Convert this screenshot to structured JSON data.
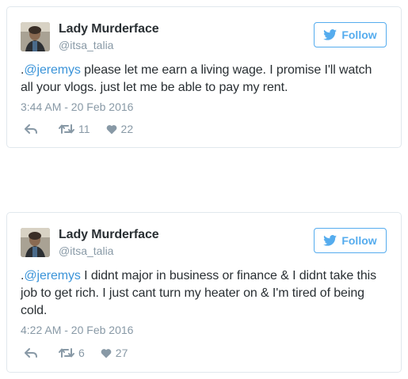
{
  "tweets": [
    {
      "display_name": "Lady Murderface",
      "handle": "@itsa_talia",
      "follow_label": "Follow",
      "text_prefix": ".",
      "mention": "@jeremys",
      "text_body": " please let me earn a living wage. I promise I'll watch all your vlogs. just let me be able to pay my rent.",
      "timestamp": "3:44 AM - 20 Feb 2016",
      "retweets": "11",
      "likes": "22"
    },
    {
      "display_name": "Lady Murderface",
      "handle": "@itsa_talia",
      "follow_label": "Follow",
      "text_prefix": ".",
      "mention": "@jeremys",
      "text_body": " I didnt major in business or finance & I didnt take this job to get rich. I just cant turn my heater on & I'm tired of being cold.",
      "timestamp": "4:22 AM - 20 Feb 2016",
      "retweets": "6",
      "likes": "27"
    }
  ],
  "colors": {
    "accent": "#55acee",
    "link": "#3b94d9",
    "muted": "#8899a6",
    "text": "#292f33",
    "border": "#e1e8ed"
  },
  "icons": {
    "follow": "twitter-bird-icon",
    "reply": "reply-icon",
    "retweet": "retweet-icon",
    "like": "heart-icon"
  }
}
